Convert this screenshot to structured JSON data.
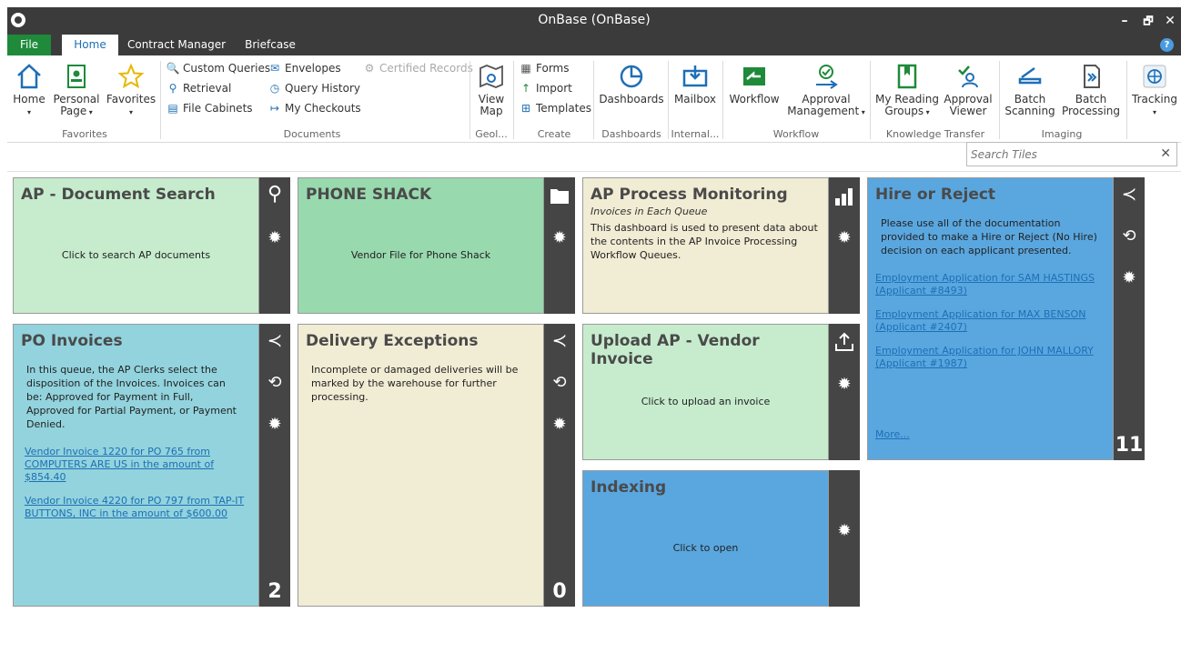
{
  "window": {
    "title": "OnBase (OnBase)",
    "minimize": "–",
    "maximize": "🗗",
    "close": "✕"
  },
  "tabs": [
    {
      "label": "File"
    },
    {
      "label": "Home"
    },
    {
      "label": "Contract Manager"
    },
    {
      "label": "Briefcase"
    }
  ],
  "help": "?",
  "ribbon": {
    "favorites": {
      "home": "Home",
      "personal_page": "Personal Page",
      "favorites": "Favorites",
      "group": "Favorites"
    },
    "documents": {
      "custom_queries": "Custom Queries",
      "retrieval": "Retrieval",
      "file_cabinets": "File Cabinets",
      "envelopes": "Envelopes",
      "query_history": "Query History",
      "my_checkouts": "My Checkouts",
      "certified_records": "Certified Records",
      "group": "Documents"
    },
    "geo": {
      "view_map": "View Map",
      "group": "Geol..."
    },
    "create": {
      "forms": "Forms",
      "import": "Import",
      "templates": "Templates",
      "group": "Create"
    },
    "dashboards": {
      "dashboards": "Dashboards",
      "group": "Dashboards"
    },
    "internal": {
      "mailbox": "Mailbox",
      "group": "Internal..."
    },
    "workflow": {
      "workflow": "Workflow",
      "approval_management": "Approval Management",
      "group": "Workflow"
    },
    "knowledge": {
      "my_reading_groups": "My Reading Groups",
      "approval_viewer": "Approval Viewer",
      "group": "Knowledge Transfer"
    },
    "imaging": {
      "batch_scanning": "Batch Scanning",
      "batch_processing": "Batch Processing",
      "group": "Imaging"
    },
    "tracking": {
      "tracking": "Tracking"
    }
  },
  "search": {
    "placeholder": "Search Tiles",
    "clear": "✕"
  },
  "tiles": {
    "ap_search": {
      "title": "AP - Document Search",
      "text": "Click to search AP documents"
    },
    "phone_shack": {
      "title": "PHONE SHACK",
      "text": "Vendor File for Phone Shack"
    },
    "ap_monitoring": {
      "title": "AP Process Monitoring",
      "subtitle": "Invoices in Each Queue",
      "text": "This dashboard is used to present data about the contents in the AP Invoice Processing Workflow Queues."
    },
    "hire_reject": {
      "title": "Hire or Reject",
      "text": "Please use all of the documentation provided to make a Hire or Reject (No Hire) decision on each applicant presented.",
      "links": [
        "Employment Application for SAM HASTINGS (Applicant #8493)",
        "Employment Application for MAX BENSON (Applicant #2407)",
        "Employment Application for JOHN MALLORY (Applicant #1987)"
      ],
      "more": "More...",
      "count": "11"
    },
    "po_invoices": {
      "title": "PO Invoices",
      "text": "In this queue, the AP Clerks select the disposition of the Invoices. Invoices can be: Approved for Payment in Full, Approved for Partial Payment, or Payment Denied.",
      "links": [
        "Vendor Invoice 1220 for PO 765 from COMPUTERS ARE US in the amount of $854.40",
        "Vendor Invoice 4220 for PO 797 from TAP-IT BUTTONS, INC in the amount of $600.00"
      ],
      "count": "2"
    },
    "delivery": {
      "title": "Delivery Exceptions",
      "text": "Incomplete or damaged deliveries will be marked by the warehouse for further processing.",
      "count": "0"
    },
    "upload": {
      "title": "Upload AP - Vendor Invoice",
      "text": "Click to upload an invoice"
    },
    "indexing": {
      "title": "Indexing",
      "text": "Click to open"
    }
  },
  "colors": {
    "accent": "#1e6fb5",
    "file_tab": "#1e8a3a",
    "sidebar": "#454545"
  }
}
